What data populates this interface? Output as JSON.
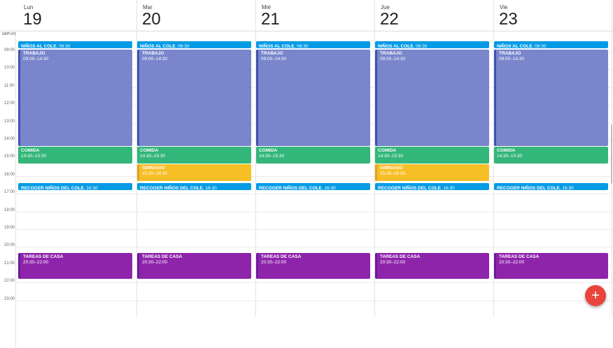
{
  "timezone": "GMT+01",
  "days": [
    {
      "dow": "Lun",
      "num": "19"
    },
    {
      "dow": "Mar",
      "num": "20"
    },
    {
      "dow": "Mié",
      "num": "21"
    },
    {
      "dow": "Jue",
      "num": "22"
    },
    {
      "dow": "Vie",
      "num": "23"
    }
  ],
  "hours": [
    "09:00",
    "10:00",
    "11:00",
    "12:00",
    "13:00",
    "14:00",
    "15:00",
    "16:00",
    "17:00",
    "18:00",
    "19:00",
    "20:00",
    "21:00",
    "22:00",
    "23:00"
  ],
  "events": {
    "ninos": {
      "title": "NIÑOS AL COLE",
      "time": ", 08:30",
      "color": "#039be5"
    },
    "trabajo": {
      "title": "TRABAJO",
      "time": "09:00–14:30",
      "color": "#7986cb",
      "bar": "#3f51b5"
    },
    "comida": {
      "title": "COMIDA",
      "time": "14:30–15:30",
      "color": "#33b679"
    },
    "gimnasio": {
      "title": "GIMNASIO",
      "time": "15:30–16:30",
      "color": "#f6bf26",
      "bar": "#e4a21a"
    },
    "recoger": {
      "title": "RECOGER NIÑOS DEL COLE",
      "time": ", 16:30",
      "color": "#039be5"
    },
    "tareas": {
      "title": "TAREAS DE CASA",
      "time": "20:30–22:00",
      "color": "#8e24aa",
      "bar": "#6a1b9a"
    }
  },
  "gimnasio_days": [
    "Mar",
    "Jue"
  ],
  "fab": {
    "label": "+"
  }
}
